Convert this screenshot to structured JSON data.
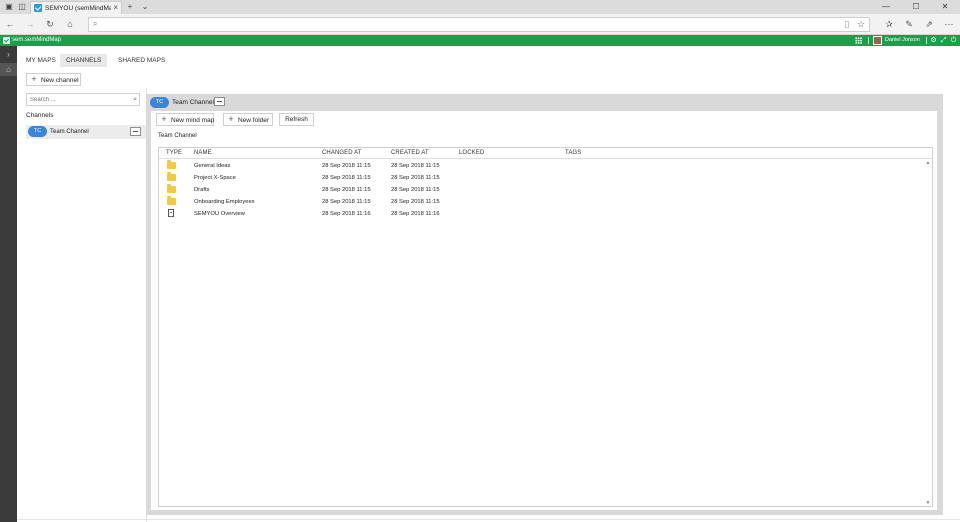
{
  "browser": {
    "tab_title": "SEMYOU (semMindMap)",
    "tab_close": "×",
    "new_tab": "+",
    "tab_list": "⌄",
    "window": {
      "minimize": "—",
      "maximize": "☐",
      "close": "✕"
    },
    "address_value": "",
    "icons": {
      "back": "back-icon",
      "forward": "forward-icon",
      "refresh": "refresh-icon",
      "home": "home-icon",
      "favorite": "star-icon"
    }
  },
  "appbar": {
    "app_name": "sem.semMindMap",
    "user_name": "Daniel Jonson",
    "color": "#1aa04a"
  },
  "nav": {
    "tabs": [
      {
        "label": "MY MAPS",
        "active": false
      },
      {
        "label": "CHANNELS",
        "active": true
      },
      {
        "label": "SHARED MAPS",
        "active": false
      }
    ]
  },
  "sidebar": {
    "new_channel_label": "New channel",
    "search_placeholder": "Search ...",
    "channels_label": "Channels",
    "channels": [
      {
        "initials": "TC",
        "name": "Team Channel"
      }
    ]
  },
  "main": {
    "channel_initials": "TC",
    "channel_name": "Team Channel",
    "toolbar": {
      "new_mind_map": "New mind map",
      "new_folder": "New folder",
      "refresh": "Refresh"
    },
    "breadcrumb": "Team Channel",
    "columns": [
      "TYPE",
      "NAME",
      "CHANGED AT",
      "CREATED AT",
      "LOCKED",
      "TAGS"
    ],
    "rows": [
      {
        "type": "folder",
        "name": "General Ideas",
        "changed": "28 Sep 2018 11:15",
        "created": "28 Sep 2018 11:15",
        "locked": "",
        "tags": ""
      },
      {
        "type": "folder",
        "name": "Project X-Space",
        "changed": "28 Sep 2018 11:15",
        "created": "28 Sep 2018 11:15",
        "locked": "",
        "tags": ""
      },
      {
        "type": "folder",
        "name": "Drafts",
        "changed": "28 Sep 2018 11:15",
        "created": "28 Sep 2018 11:15",
        "locked": "",
        "tags": ""
      },
      {
        "type": "folder",
        "name": "Onboarding Employees",
        "changed": "28 Sep 2018 11:15",
        "created": "28 Sep 2018 11:15",
        "locked": "",
        "tags": ""
      },
      {
        "type": "document",
        "name": "SEMYOU Overview",
        "changed": "28 Sep 2018 11:16",
        "created": "28 Sep 2018 11:16",
        "locked": "",
        "tags": ""
      }
    ]
  },
  "colors": {
    "accent": "#3a84d9",
    "brand": "#1aa04a",
    "folder": "#f2c84b"
  }
}
